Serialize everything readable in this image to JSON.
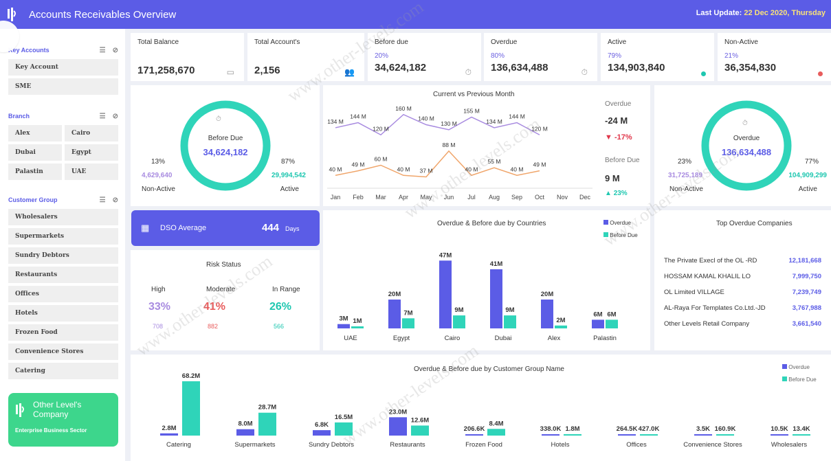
{
  "header": {
    "title": "Accounts Receivables Overview",
    "last_update_label": "Last Update:",
    "last_update_value": "22 Dec 2020, Thursday"
  },
  "sidebar": {
    "key_accounts": {
      "title": "Key Accounts",
      "items": [
        "Key Account",
        "SME"
      ]
    },
    "branch": {
      "title": "Branch",
      "items": [
        "Alex",
        "Cairo",
        "Dubai",
        "Egypt",
        "Palastin",
        "UAE"
      ]
    },
    "customer_group": {
      "title": "Customer Group",
      "items": [
        "Wholesalers",
        "Supermarkets",
        "Sundry Debtors",
        "Restaurants",
        "Offices",
        "Hotels",
        "Frozen Food",
        "Convenience Stores",
        "Catering"
      ]
    },
    "company": {
      "name1": "Other Level's",
      "name2": "Company",
      "sub": "Enterprise Business Sector"
    }
  },
  "kpis": [
    {
      "label": "Total Balance",
      "pct": "",
      "value": "171,258,670",
      "icon": "cash-register-icon"
    },
    {
      "label": "Total Account's",
      "pct": "",
      "value": "2,156",
      "icon": "users-icon"
    },
    {
      "label": "Before due",
      "pct": "20%",
      "value": "34,624,182",
      "icon": "stopwatch-icon"
    },
    {
      "label": "Overdue",
      "pct": "80%",
      "value": "136,634,488",
      "icon": "stopwatch-filled-icon"
    },
    {
      "label": "Active",
      "pct": "79%",
      "value": "134,903,840",
      "dot": "#1fc7b0"
    },
    {
      "label": "Non-Active",
      "pct": "21%",
      "value": "36,354,830",
      "dot": "#e85c5c"
    }
  ],
  "before_due_donut": {
    "center_label": "Before Due",
    "center_value": "34,624,182",
    "left_pct": "13%",
    "left_value": "4,629,640",
    "left_label": "Non-Active",
    "right_pct": "87%",
    "right_value": "29,994,542",
    "right_label": "Active",
    "share": 0.87
  },
  "overdue_donut": {
    "center_label": "Overdue",
    "center_value": "136,634,488",
    "left_pct": "23%",
    "left_value": "31,725,189",
    "left_label": "Non-Active",
    "right_pct": "77%",
    "right_value": "104,909,299",
    "right_label": "Active",
    "share": 0.77
  },
  "month_compare": {
    "overdue_label": "Overdue",
    "overdue_value": "-24 M",
    "overdue_change": "-17%",
    "before_label": "Before Due",
    "before_value": "9 M",
    "before_change": "23%",
    "down_color": "#e0364a",
    "up_color": "#1fc7b0"
  },
  "dso": {
    "label": "DSO Average",
    "value": "444",
    "unit": "Days"
  },
  "risk": {
    "title": "Risk Status",
    "cols": [
      {
        "label": "High",
        "pct": "33%",
        "count": "708",
        "color": "#a88be0"
      },
      {
        "label": "Moderate",
        "pct": "41%",
        "count": "882",
        "color": "#e85c5c"
      },
      {
        "label": "In Range",
        "pct": "26%",
        "count": "566",
        "color": "#1fc7b0"
      }
    ]
  },
  "top_overdue": {
    "title": "Top Overdue Companies",
    "rows": [
      {
        "name": "The Private Execl of the OL -RD",
        "value": "12,181,668"
      },
      {
        "name": "HOSSAM KAMAL KHALIL LO",
        "value": "7,999,750"
      },
      {
        "name": "OL Limited VILLAGE",
        "value": "7,239,749"
      },
      {
        "name": "AL-Raya For Templates Co.Ltd.-JD",
        "value": "3,767,988"
      },
      {
        "name": "Other Levels Retail Company",
        "value": "3,661,540"
      }
    ]
  },
  "watermark": "www.other-levels.com",
  "chart_data": [
    {
      "type": "line",
      "title": "Current vs Previous Month",
      "categories": [
        "Jan",
        "Feb",
        "Mar",
        "Apr",
        "May",
        "Jun",
        "Jul",
        "Aug",
        "Sep",
        "Oct",
        "Nov",
        "Dec"
      ],
      "series": [
        {
          "color": "#a88be0",
          "values": [
            134,
            144,
            120,
            160,
            140,
            130,
            155,
            134,
            144,
            120
          ],
          "labels": [
            "134 M",
            "144 M",
            "120 M",
            "160 M",
            "140 M",
            "130 M",
            "155 M",
            "134 M",
            "144 M",
            "120 M"
          ]
        },
        {
          "color": "#f0a56a",
          "values": [
            40,
            49,
            60,
            40,
            37,
            88,
            40,
            55,
            40,
            49
          ],
          "labels": [
            "40 M",
            "49 M",
            "60 M",
            "40 M",
            "37 M",
            "88 M",
            "40 M",
            "55 M",
            "40 M",
            "49 M"
          ]
        }
      ],
      "ylim": [
        20,
        180
      ]
    },
    {
      "type": "bar",
      "title": "Overdue & Before due by Countries",
      "categories": [
        "UAE",
        "Egypt",
        "Cairo",
        "Dubai",
        "Alex",
        "Palastin"
      ],
      "series": [
        {
          "name": "Overdue",
          "color": "#5b5ce6",
          "values": [
            3,
            20,
            47,
            41,
            20,
            6
          ],
          "labels": [
            "3M",
            "20M",
            "47M",
            "41M",
            "20M",
            "6M"
          ]
        },
        {
          "name": "Before Due",
          "color": "#2fd4b9",
          "values": [
            1,
            7,
            9,
            9,
            2,
            6
          ],
          "labels": [
            "1M",
            "7M",
            "9M",
            "9M",
            "2M",
            "6M"
          ]
        }
      ]
    },
    {
      "type": "bar",
      "title": "Overdue & Before due by Customer Group Name",
      "categories": [
        "Catering",
        "Supermarkets",
        "Sundry Debtors",
        "Restaurants",
        "Frozen Food",
        "Hotels",
        "Offices",
        "Convenience Stores",
        "Wholesalers"
      ],
      "series": [
        {
          "name": "Overdue",
          "color": "#5b5ce6",
          "values": [
            2.8,
            8.0,
            6.8,
            23.0,
            0.2066,
            0.338,
            0.2645,
            0.0035,
            0.0105
          ],
          "labels": [
            "2.8M",
            "8.0M",
            "6.8K",
            "23.0M",
            "206.6K",
            "338.0K",
            "264.5K",
            "3.5K",
            "10.5K"
          ]
        },
        {
          "name": "Before Due",
          "color": "#2fd4b9",
          "values": [
            68.2,
            28.7,
            16.5,
            12.6,
            8.4,
            1.8,
            0.427,
            0.1609,
            0.0134
          ],
          "labels": [
            "68.2M",
            "28.7M",
            "16.5M",
            "12.6M",
            "8.4M",
            "1.8M",
            "427.0K",
            "160.9K",
            "13.4K"
          ]
        }
      ]
    }
  ]
}
